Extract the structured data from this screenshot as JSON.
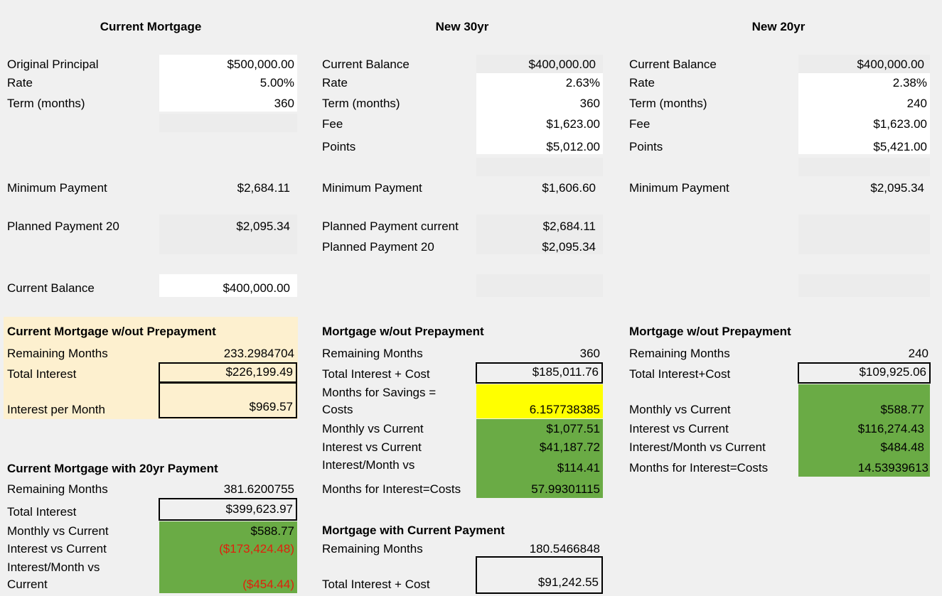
{
  "headers": {
    "current": "Current Mortgage",
    "new30": "New 30yr",
    "new20": "New 20yr"
  },
  "current": {
    "original_principal_label": "Original Principal",
    "original_principal": "$500,000.00",
    "rate_label": "Rate",
    "rate": "5.00%",
    "term_label": "Term (months)",
    "term": "360",
    "min_payment_label": "Minimum Payment",
    "min_payment": "$2,684.11",
    "planned20_label": "Planned Payment 20",
    "planned20": "$2,095.34",
    "balance_label": "Current Balance",
    "balance": "$400,000.00",
    "noprepay": {
      "title": "Current Mortgage w/out Prepayment",
      "remaining_label": "Remaining Months",
      "remaining": "233.2984704",
      "total_interest_label": "Total Interest",
      "total_interest": "$226,199.49",
      "ipm_label": "Interest per Month",
      "ipm": "$969.57"
    },
    "with20": {
      "title": "Current Mortgage with 20yr Payment",
      "remaining_label": "Remaining Months",
      "remaining": "381.6200755",
      "total_interest_label": "Total Interest",
      "total_interest": "$399,623.97",
      "monthly_label": "Monthly vs Current",
      "monthly": "$588.77",
      "interest_label": "Interest vs Current",
      "interest": "($173,424.48)",
      "ipm_label_1": "Interest/Month vs",
      "ipm_label_2": "Current",
      "ipm": "($454.44)"
    }
  },
  "new30": {
    "balance_label": "Current Balance",
    "balance": "$400,000.00",
    "rate_label": "Rate",
    "rate": "2.63%",
    "term_label": "Term (months)",
    "term": "360",
    "fee_label": "Fee",
    "fee": "$1,623.00",
    "points_label": "Points",
    "points": "$5,012.00",
    "min_payment_label": "Minimum Payment",
    "min_payment": "$1,606.60",
    "planned_current_label": "Planned Payment current",
    "planned_current": "$2,684.11",
    "planned20_label": "Planned Payment 20",
    "planned20": "$2,095.34",
    "noprepay": {
      "title": "Mortgage w/out Prepayment",
      "remaining_label": "Remaining Months",
      "remaining": "360",
      "total_label": "Total Interest + Cost",
      "total": "$185,011.76",
      "savings_label_1": "Months for Savings =",
      "savings_label_2": "Costs",
      "savings": "6.157738385",
      "monthly_label": "Monthly vs Current",
      "monthly": "$1,077.51",
      "interest_label": "Interest vs Current",
      "interest": "$41,187.72",
      "ipm_label": "Interest/Month vs",
      "ipm": "$114.41",
      "months_ic_label": "Months for Interest=Costs",
      "months_ic": "57.99301115"
    },
    "withcurrent": {
      "title": "Mortgage with Current Payment",
      "remaining_label": "Remaining Months",
      "remaining": "180.5466848",
      "total_label": "Total Interest + Cost",
      "total": "$91,242.55"
    }
  },
  "new20": {
    "balance_label": "Current Balance",
    "balance": "$400,000.00",
    "rate_label": "Rate",
    "rate": "2.38%",
    "term_label": "Term (months)",
    "term": "240",
    "fee_label": "Fee",
    "fee": "$1,623.00",
    "points_label": "Points",
    "points": "$5,421.00",
    "min_payment_label": "Minimum Payment",
    "min_payment": "$2,095.34",
    "noprepay": {
      "title": "Mortgage w/out Prepayment",
      "remaining_label": "Remaining Months",
      "remaining": "240",
      "total_label": "Total Interest+Cost",
      "total": "$109,925.06",
      "monthly_label": "Monthly vs Current",
      "monthly": "$588.77",
      "interest_label": "Interest vs Current",
      "interest": "$116,274.43",
      "ipm_label": "Interest/Month vs Current",
      "ipm": "$484.48",
      "months_ic_label": "Months for Interest=Costs",
      "months_ic": "14.53939613"
    }
  },
  "colors": {
    "green": "#6aab45",
    "yellow": "#ffff00",
    "cream": "#fdf0cf",
    "negative": "#e0200c"
  }
}
